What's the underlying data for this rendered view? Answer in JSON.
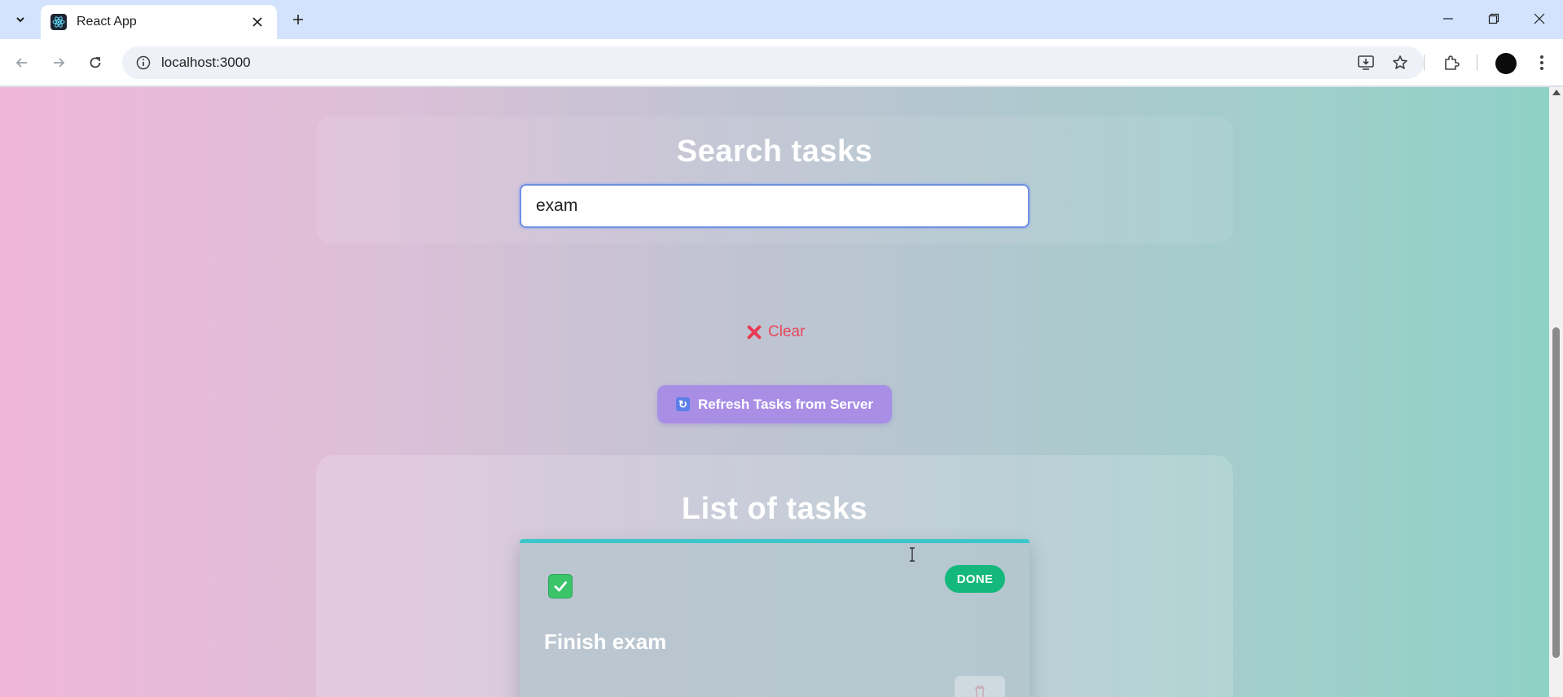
{
  "browser": {
    "tab_title": "React App",
    "url": "localhost:3000"
  },
  "search": {
    "title": "Search tasks",
    "input_value": "exam",
    "clear_label": "Clear"
  },
  "refresh": {
    "label": "Refresh Tasks from Server"
  },
  "list": {
    "title": "List of tasks",
    "tasks": [
      {
        "title": "Finish exam",
        "status": "DONE",
        "completed": true
      }
    ]
  },
  "colors": {
    "accent": "#a98ee6",
    "done": "#14b87c",
    "clear": "#e8475a",
    "card_top": "#3cc6c8"
  }
}
